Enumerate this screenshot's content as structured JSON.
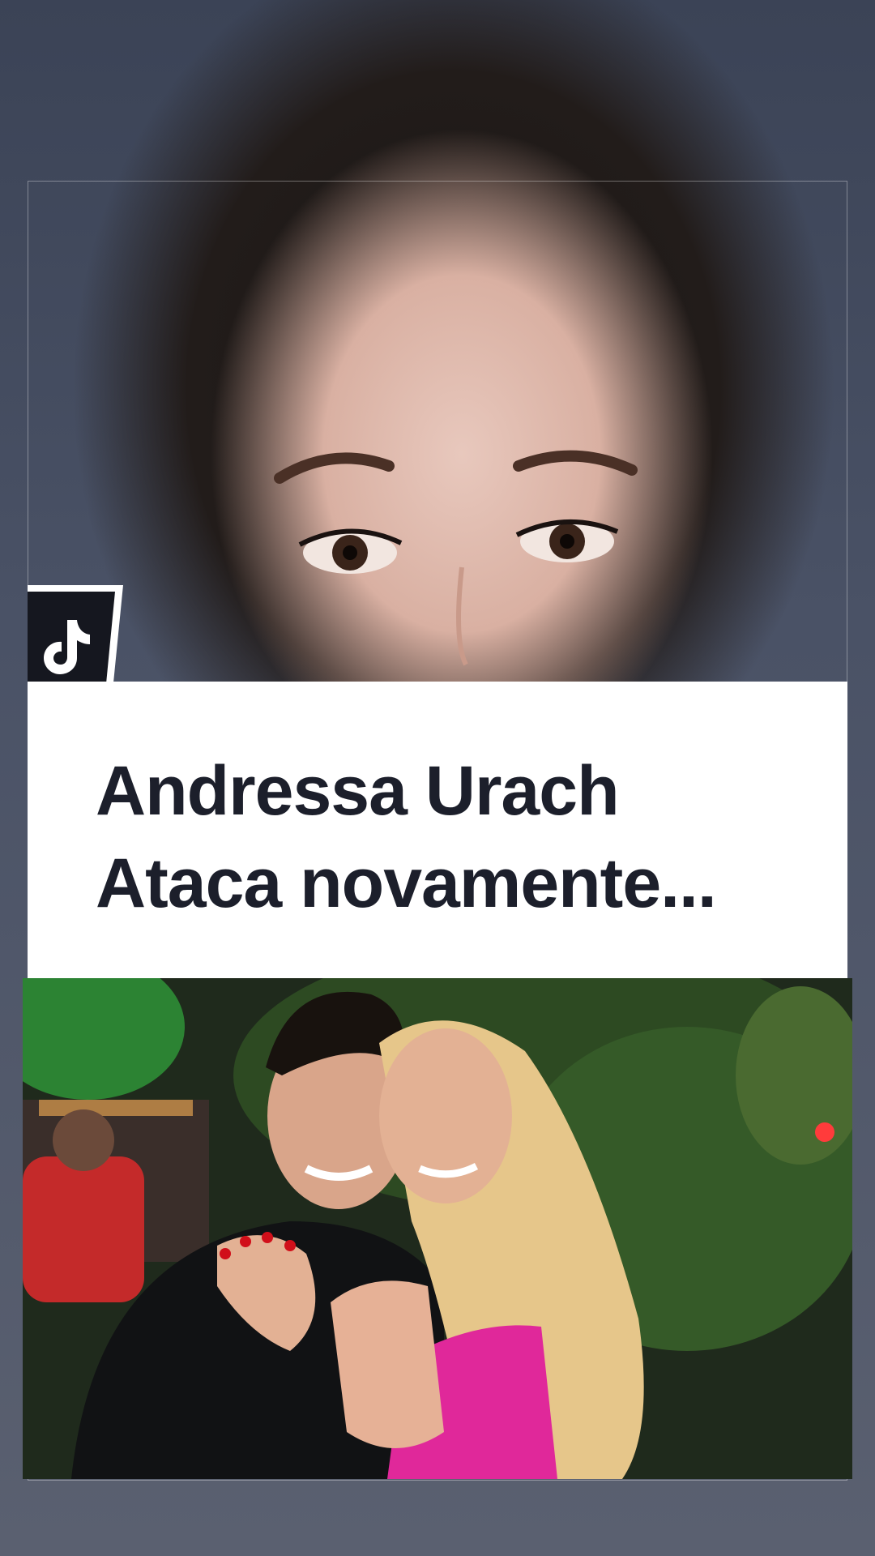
{
  "video": {
    "headline_line1": "Andressa Urach",
    "headline_line2": "Ataca novamente..."
  },
  "icons": {
    "app_logo": "tiktok-logo-icon"
  },
  "colors": {
    "headline_text": "#1c1f2b",
    "card_background": "#ffffff",
    "logo_background": "#15171f"
  }
}
